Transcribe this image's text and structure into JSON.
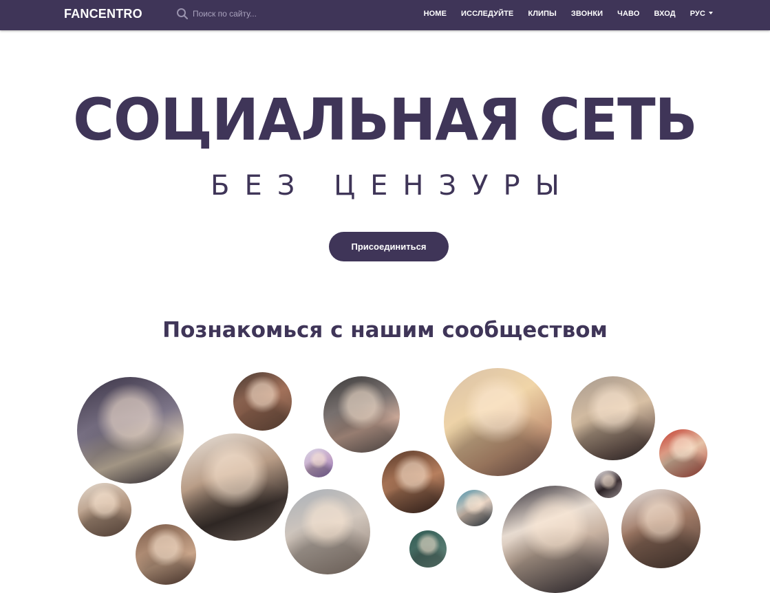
{
  "header": {
    "logo_text": "FANCENTRO",
    "search": {
      "placeholder": "Поиск по сайту..."
    },
    "nav": [
      {
        "label": "HOME"
      },
      {
        "label": "ИССЛЕДУЙТЕ"
      },
      {
        "label": "КЛИПЫ"
      },
      {
        "label": "ЗВОНКИ"
      },
      {
        "label": "ЧАВО"
      },
      {
        "label": "ВХОД"
      }
    ],
    "language": {
      "label": "РУС"
    }
  },
  "hero": {
    "title": "СОЦИАЛЬНАЯ СЕТЬ",
    "subtitle": "БЕЗ ЦЕНЗУРЫ",
    "join_button_label": "Присоединиться"
  },
  "community": {
    "title": "Познакомься с нашим сообществом"
  },
  "colors": {
    "brand": "#3f3558",
    "background": "#ffffff"
  }
}
